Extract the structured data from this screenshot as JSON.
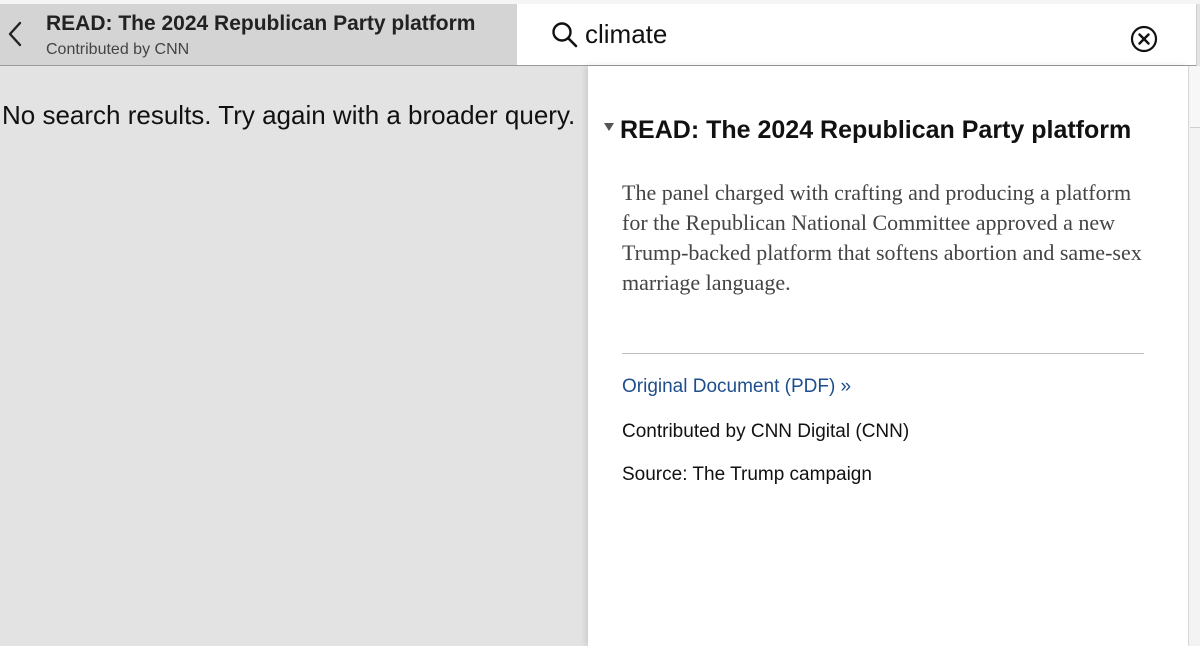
{
  "header": {
    "doc_title": "READ: The 2024 Republican Party platform",
    "contributor": "Contributed by CNN"
  },
  "search": {
    "value": "climate",
    "placeholder": ""
  },
  "results": {
    "empty_message": "No search results. Try again with a broader query."
  },
  "info": {
    "title": "READ: The 2024 Republican Party platform",
    "description": "The panel charged with crafting and producing a platform for the Republican National Committee approved a new Trump-backed platform that softens abortion and same-sex marriage language.",
    "original_link": "Original Document (PDF) »",
    "contributed_by": "Contributed by CNN Digital (CNN)",
    "source": "Source: The Trump campaign"
  },
  "icons": {
    "back": "chevron-left-icon",
    "search": "search-icon",
    "clear": "close-circle-icon",
    "collapse": "triangle-down-icon"
  },
  "colors": {
    "header_background": "#d4d4d4",
    "page_background": "#e3e3e3",
    "panel_background": "#ffffff",
    "link": "#1f4e8c",
    "description_text": "#444444"
  }
}
